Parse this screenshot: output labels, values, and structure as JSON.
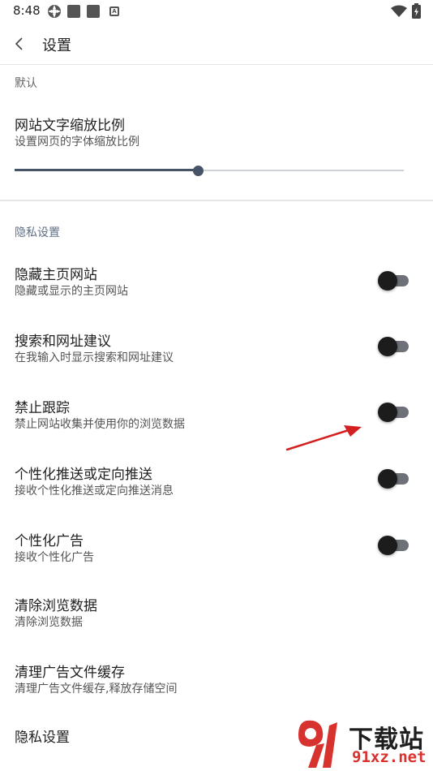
{
  "status_bar": {
    "time": "8:48",
    "icons": [
      "pinwheel-icon",
      "square-icon",
      "square-icon",
      "a-notification-icon",
      "wifi-icon",
      "battery-charging-icon"
    ],
    "a_badge": "A"
  },
  "app_bar": {
    "back_icon": "chevron-left-icon",
    "title": "设置"
  },
  "sections": {
    "default": {
      "header": "默认"
    },
    "privacy": {
      "header": "隐私设置"
    }
  },
  "font_scale": {
    "title": "网站文字缩放比例",
    "subtitle": "设置网页的字体缩放比例",
    "slider_fraction": 0.47
  },
  "privacy_items": [
    {
      "title": "隐藏主页网站",
      "subtitle": "隐藏或显示的主页网站",
      "toggle_on": false
    },
    {
      "title": "搜索和网址建议",
      "subtitle": "在我输入时显示搜索和网址建议",
      "toggle_on": false
    },
    {
      "title": "禁止跟踪",
      "subtitle": "禁止网站收集并使用你的浏览数据",
      "toggle_on": false
    },
    {
      "title": "个性化推送或定向推送",
      "subtitle": "接收个性化推送或定向推送消息",
      "toggle_on": false
    },
    {
      "title": "个性化广告",
      "subtitle": "接收个性化广告",
      "toggle_on": false
    },
    {
      "title": "清除浏览数据",
      "subtitle": "清除浏览数据"
    },
    {
      "title": "清理广告文件缓存",
      "subtitle": "清理广告文件缓存,释放存储空间"
    },
    {
      "title": "隐私设置"
    }
  ],
  "colors": {
    "accent": "#475468",
    "section_header_blue": "#5f6f86",
    "toggle_off_track": "#6e7278",
    "toggle_off_knob": "#1c1c1c",
    "annotation_arrow": "#d42020",
    "watermark_red": "#d8322e"
  },
  "watermark": {
    "title": "下载站",
    "url": "91xz.net",
    "logo_icon": "91-logo-icon"
  }
}
